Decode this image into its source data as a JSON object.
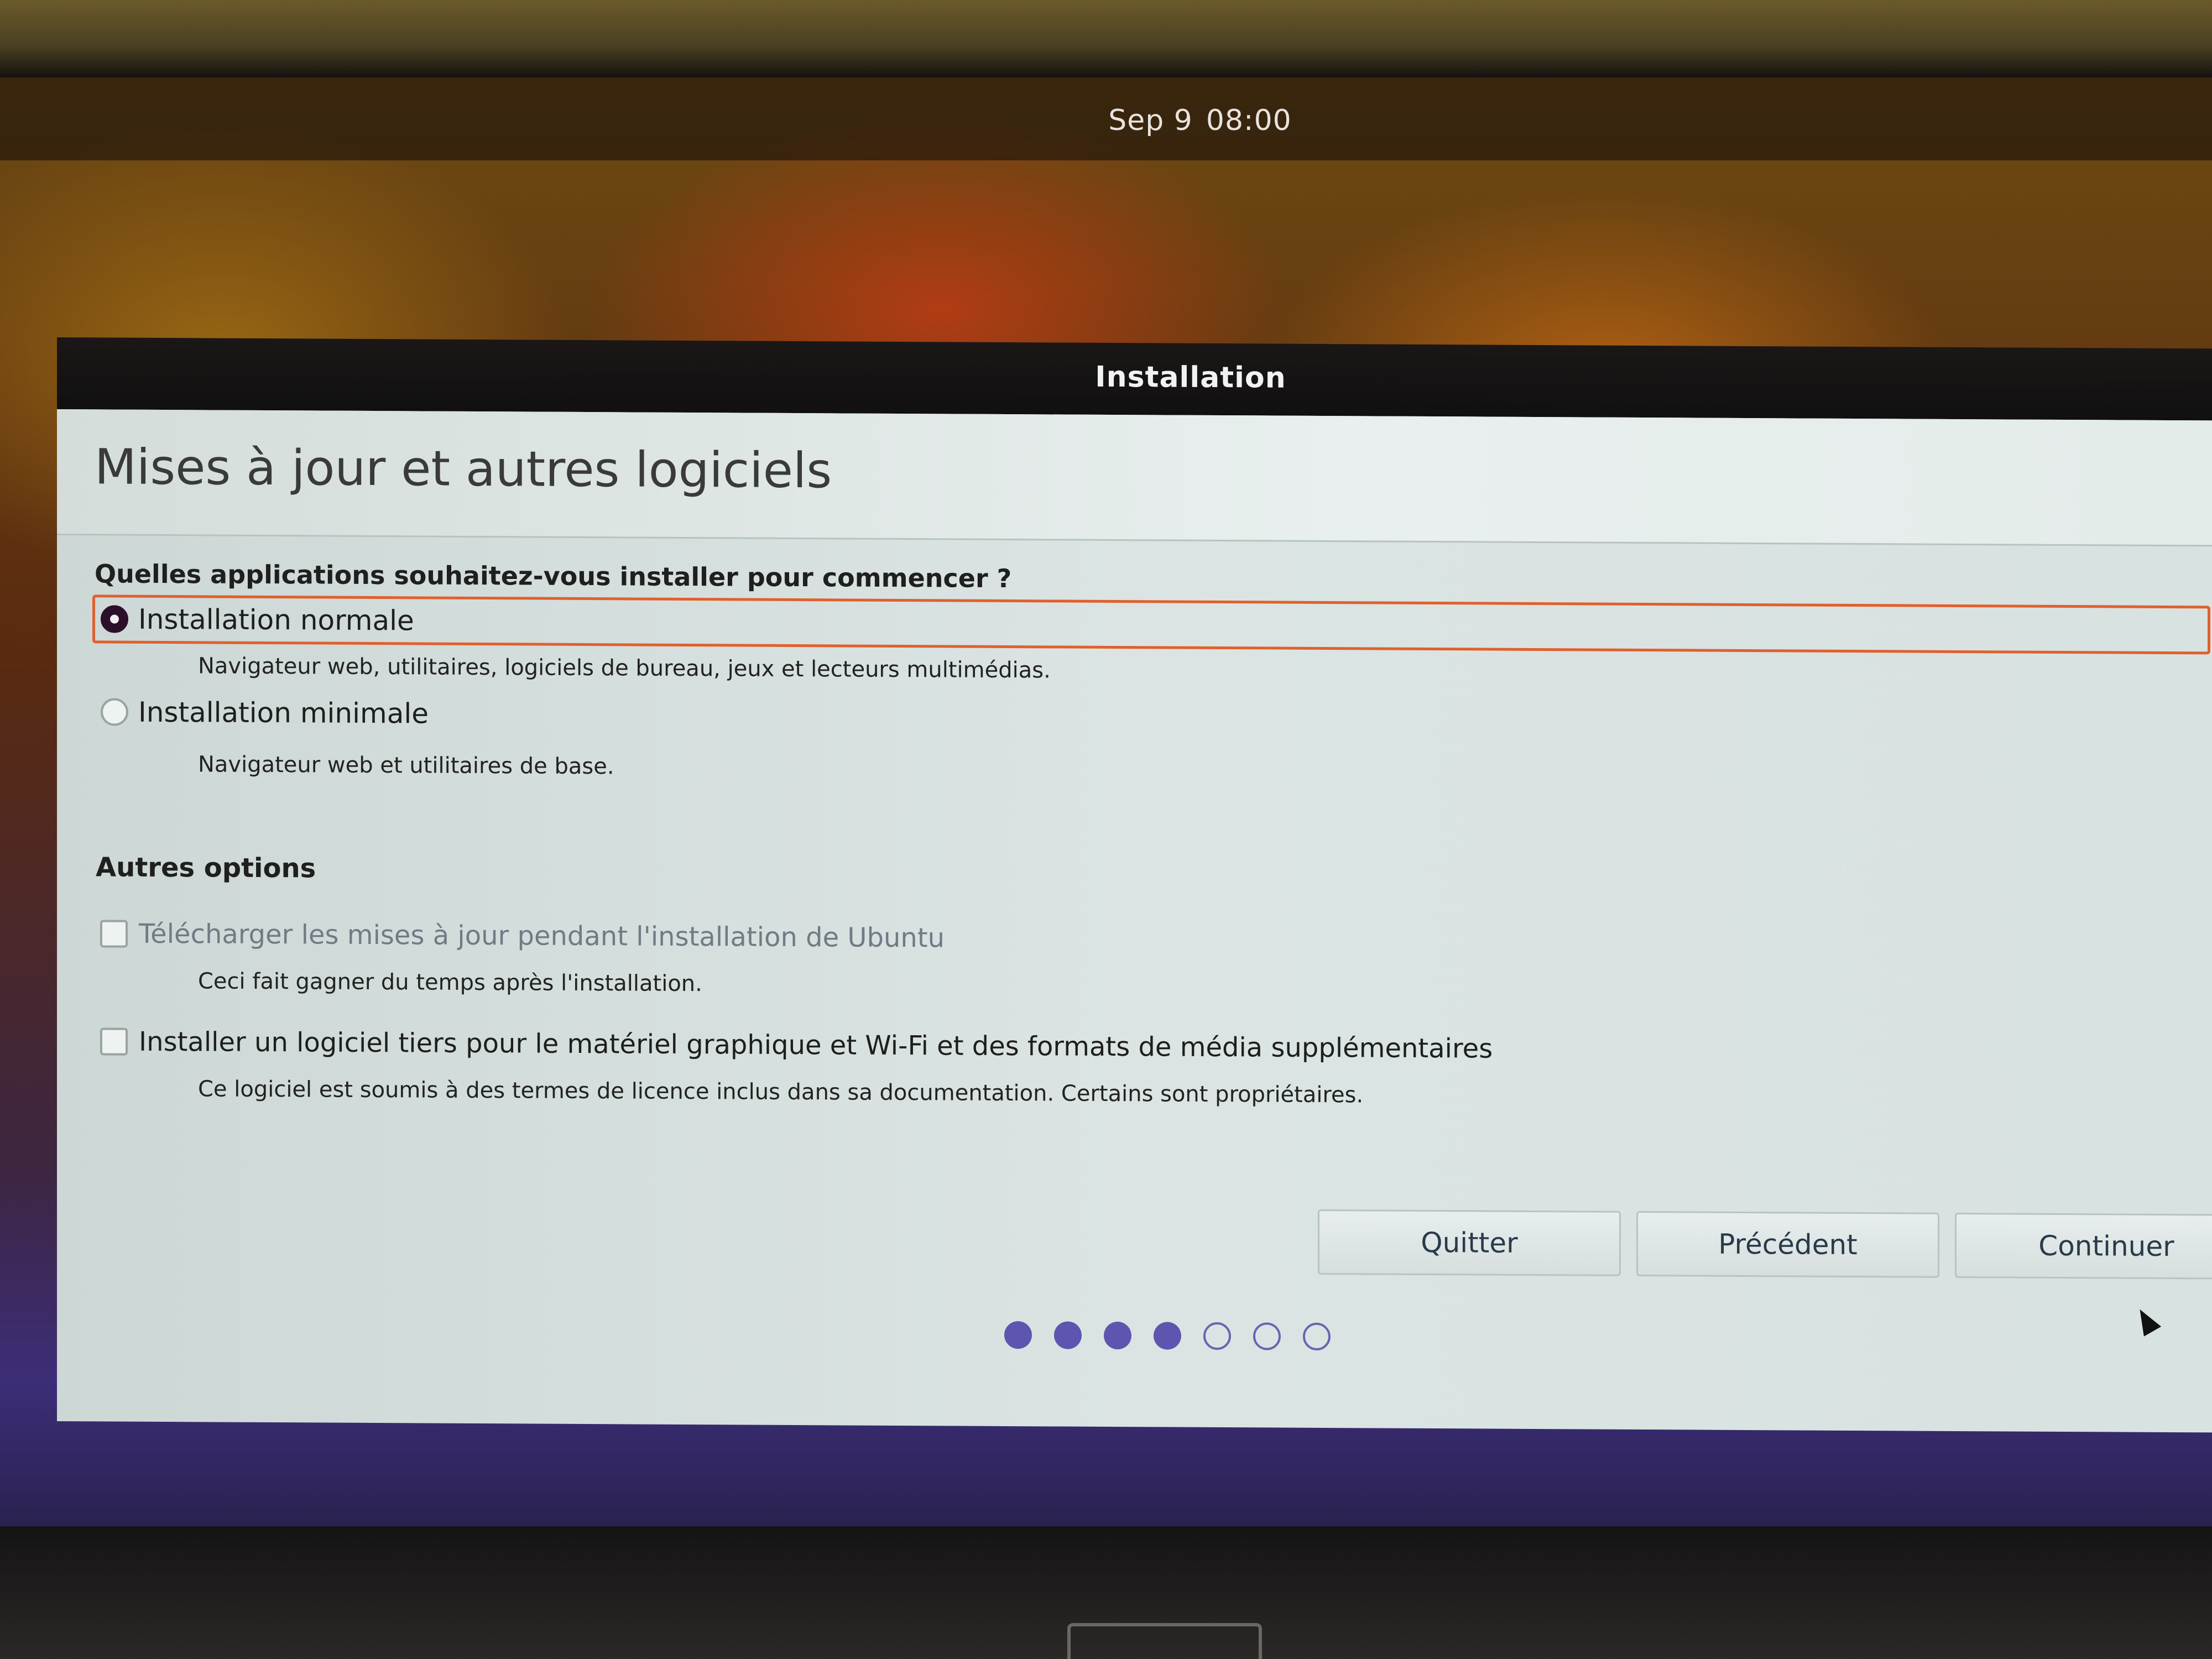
{
  "topbar": {
    "date": "Sep 9",
    "time": "08:00"
  },
  "window": {
    "title": "Installation"
  },
  "page": {
    "title": "Mises à jour et autres logiciels",
    "question": "Quelles applications souhaitez-vous installer pour commencer ?"
  },
  "install_type": {
    "options": [
      {
        "label": "Installation normale",
        "description": "Navigateur web, utilitaires, logiciels de bureau, jeux et lecteurs multimédias.",
        "selected": true
      },
      {
        "label": "Installation minimale",
        "description": "Navigateur web et utilitaires de base.",
        "selected": false
      }
    ]
  },
  "other_options": {
    "heading": "Autres options",
    "items": [
      {
        "label": "Télécharger les mises à jour pendant l'installation de Ubuntu",
        "description": "Ceci fait gagner du temps après l'installation.",
        "checked": false,
        "enabled": false
      },
      {
        "label": "Installer un logiciel tiers pour le matériel graphique et Wi-Fi et des formats de média supplémentaires",
        "description": "Ce logiciel est soumis à des termes de licence inclus dans sa documentation. Certains sont propriétaires.",
        "checked": false,
        "enabled": true
      }
    ]
  },
  "buttons": {
    "quit": "Quitter",
    "back": "Précédent",
    "continue": "Continuer"
  },
  "progress": {
    "total_steps": 7,
    "completed_steps": 4
  },
  "colors": {
    "selection_border": "#e0602e",
    "radio_checked": "#2c0f2a",
    "progress_dot": "#5e55b0"
  },
  "icons": {
    "cursor": "mouse-pointer-icon"
  }
}
